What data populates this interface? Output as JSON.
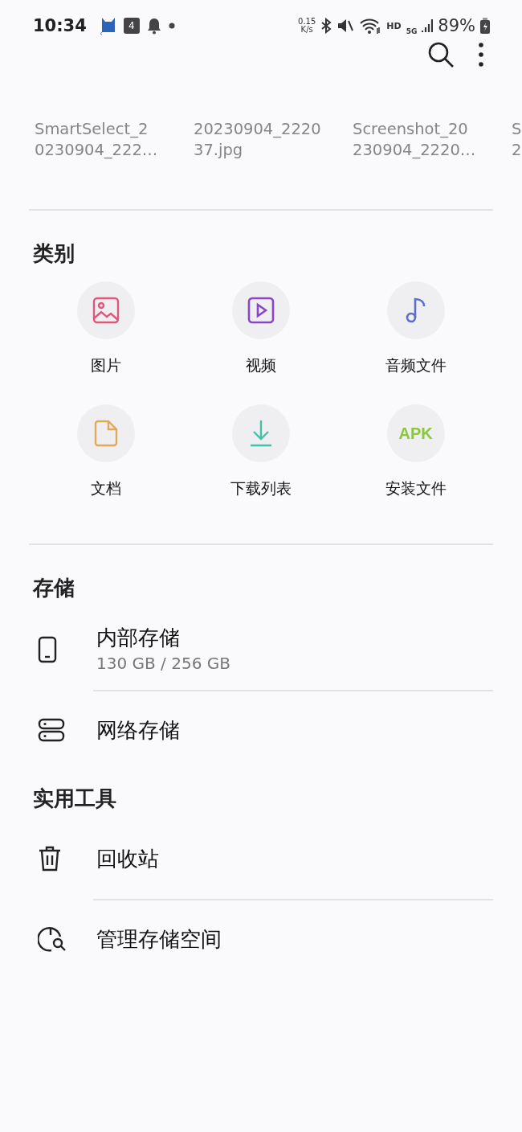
{
  "status_bar": {
    "time": "10:34",
    "calendar_badge": "4",
    "net_speed": "0.15",
    "net_unit": "K/s",
    "hd": "HD",
    "network": "5G",
    "battery": "89%"
  },
  "recent_files": [
    {
      "lines": [
        "SmartSelect_2",
        "0230904_222…"
      ]
    },
    {
      "lines": [
        "20230904_2220",
        "37.jpg"
      ]
    },
    {
      "lines": [
        "Screenshot_20",
        "230904_2220…"
      ]
    },
    {
      "lines": [
        "S",
        "2"
      ]
    }
  ],
  "categories": {
    "title": "类别",
    "items": [
      {
        "label": "图片",
        "kind": "image",
        "color": "#e0577a"
      },
      {
        "label": "视频",
        "kind": "video",
        "color": "#8a45c8"
      },
      {
        "label": "音频文件",
        "kind": "audio",
        "color": "#5b6ec9"
      },
      {
        "label": "文档",
        "kind": "document",
        "color": "#e0a95a"
      },
      {
        "label": "下载列表",
        "kind": "download",
        "color": "#3fc2a8"
      },
      {
        "label": "安装文件",
        "kind": "apk",
        "color": "#8cc63f",
        "icon_text": "APK"
      }
    ]
  },
  "storage": {
    "title": "存储",
    "items": [
      {
        "label": "内部存储",
        "detail": "130 GB / 256 GB",
        "kind": "phone"
      },
      {
        "label": "网络存储",
        "kind": "server"
      }
    ]
  },
  "tools": {
    "title": "实用工具",
    "items": [
      {
        "label": "回收站",
        "kind": "trash"
      },
      {
        "label": "管理存储空间",
        "kind": "storage-search"
      }
    ]
  }
}
